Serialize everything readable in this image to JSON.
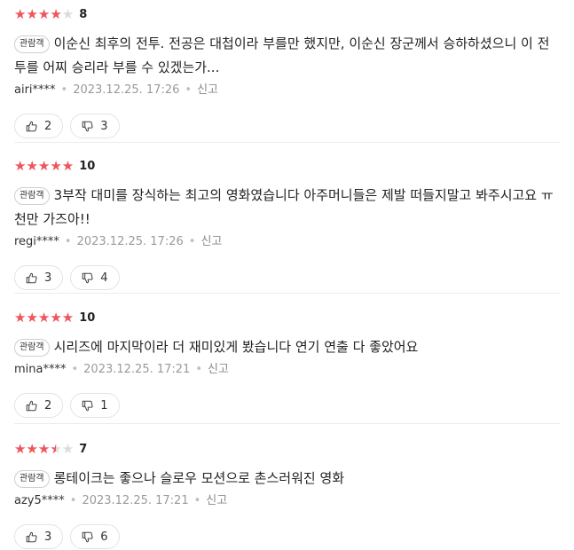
{
  "colors": {
    "star_fill": "#f1545d",
    "star_empty": "#dcdcdc",
    "badge_border": "#cfcfcf"
  },
  "reviews": [
    {
      "rating_fraction": 0.8,
      "score": "8",
      "badge": "관람객",
      "text": "이순신 최후의 전투. 전공은 대첩이라 부를만 했지만, 이순신 장군께서 승하하셨으니 이 전투를 어찌 승리라 부를 수 있겠는가...",
      "user": "airi****",
      "date": "2023.12.25. 17:26",
      "report": "신고",
      "likes": "2",
      "dislikes": "3"
    },
    {
      "rating_fraction": 1.0,
      "score": "10",
      "badge": "관람객",
      "text": "3부작 대미를 장식하는 최고의 영화였습니다 아주머니들은 제발 떠들지말고 봐주시고요 ㅠ 천만 가즈아!!",
      "user": "regi****",
      "date": "2023.12.25. 17:26",
      "report": "신고",
      "likes": "3",
      "dislikes": "4"
    },
    {
      "rating_fraction": 1.0,
      "score": "10",
      "badge": "관람객",
      "text": "시리즈에 마지막이라 더 재미있게 봤습니다 연기 연출 다 좋았어요",
      "user": "mina****",
      "date": "2023.12.25. 17:21",
      "report": "신고",
      "likes": "2",
      "dislikes": "1"
    },
    {
      "rating_fraction": 0.7,
      "score": "7",
      "badge": "관람객",
      "text": "롱테이크는 좋으나 슬로우 모션으로 촌스러워진 영화",
      "user": "azy5****",
      "date": "2023.12.25. 17:21",
      "report": "신고",
      "likes": "3",
      "dislikes": "6"
    }
  ]
}
